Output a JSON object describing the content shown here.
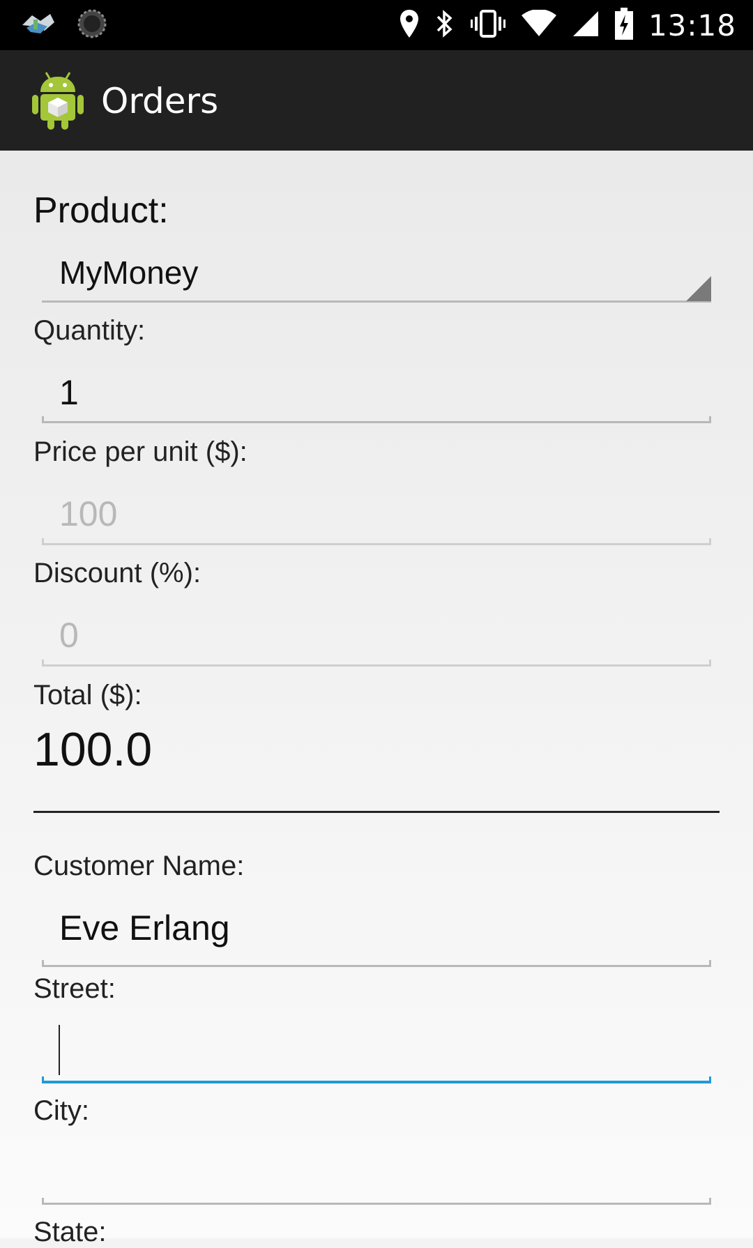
{
  "status_bar": {
    "time": "13:18",
    "icons": [
      "app-notification-icon",
      "sync-icon",
      "location-icon",
      "bluetooth-icon",
      "vibrate-icon",
      "wifi-icon",
      "signal-icon",
      "battery-charging-icon"
    ]
  },
  "action_bar": {
    "title": "Orders",
    "app_icon": "android-app-icon"
  },
  "form": {
    "product": {
      "label": "Product:",
      "value": "MyMoney"
    },
    "quantity": {
      "label": "Quantity:",
      "value": "1"
    },
    "price": {
      "label": "Price per unit ($):",
      "value": "100"
    },
    "discount": {
      "label": "Discount (%):",
      "value": "0"
    },
    "total": {
      "label": "Total ($):",
      "value": "100.0"
    },
    "customer_name": {
      "label": "Customer Name:",
      "value": "Eve Erlang"
    },
    "street": {
      "label": "Street:",
      "value": ""
    },
    "city": {
      "label": "City:",
      "value": ""
    },
    "state": {
      "label": "State:"
    }
  },
  "colors": {
    "focus_accent": "#1f9ad6",
    "action_bar": "#212121",
    "android_green": "#a4c639"
  }
}
